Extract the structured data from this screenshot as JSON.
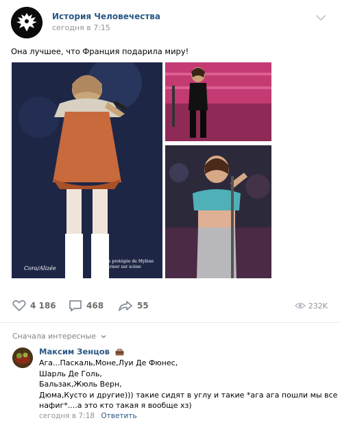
{
  "post": {
    "group_name": "История Человечества",
    "time": "сегодня в 7:15",
    "text": "Она лучшее, что Франция подарила миру!",
    "photos": {
      "main_caption_left": "Cora/Alizée",
      "main_caption_right": "Alizée, la protégée de Mylène Farmer sur scène"
    },
    "actions": {
      "likes": "4 186",
      "comments": "468",
      "shares": "55",
      "views": "232K"
    }
  },
  "comments": {
    "sort_label": "Сначала интересные",
    "items": [
      {
        "author": "Максим Зенцов",
        "lines": [
          "Ага...Паскаль,Моне,Луи Де Фюнес,",
          "Шарль Де Голь,",
          "Бальзак,Жюль Верн,",
          "Дюма,Кусто и другие))) такие сидят в углу и такие *ага ага пошли мы все",
          "нафиг*....а это кто такая я вообще хз)"
        ],
        "time": "сегодня в 7:18",
        "reply_label": "Ответить"
      }
    ]
  },
  "colors": {
    "link": "#2a5885",
    "muted": "#939393",
    "divider": "#e7e8ec"
  }
}
